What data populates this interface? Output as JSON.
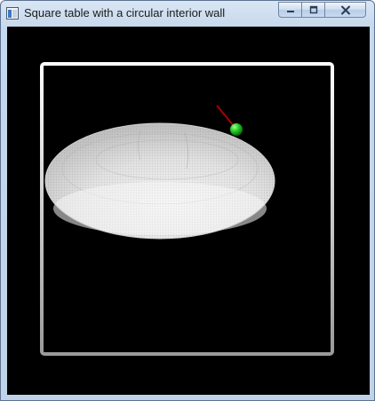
{
  "window": {
    "title": "Square table with a circular interior wall",
    "icons": {
      "app": "opengl-window-icon",
      "minimize": "minimize-icon",
      "maximize": "maximize-icon",
      "close": "close-icon"
    }
  },
  "scene": {
    "background_color": "#000000",
    "table_border": "square-wall",
    "interior_wall": "circular-wall",
    "ball_color": "#22cc22",
    "velocity_vector_color": "#aa0000",
    "wall_color": "#eeeeee"
  }
}
